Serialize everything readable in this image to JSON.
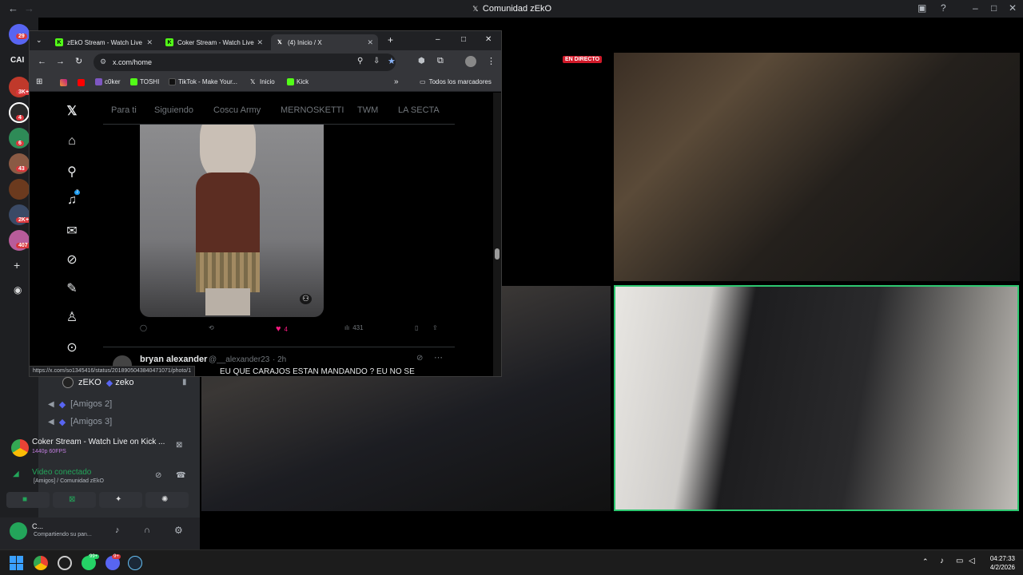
{
  "discord": {
    "window_title": "Comunidad zEkO",
    "channel_header": "Comunidad zEkO",
    "server_badges": [
      "29",
      "3K+",
      "4",
      "6",
      "43",
      "2K+",
      "407"
    ],
    "voice_channel": {
      "user": "zEKO",
      "user_tag": "zeko",
      "sub_channels": [
        "[Amigos 2]",
        "[Amigos 3]"
      ]
    },
    "stream_panel": {
      "title": "Coker Stream - Watch Live on Kick ...",
      "quality": "1440p 60FPS"
    },
    "voice_panel": {
      "status": "Video conectado",
      "location": "[Amigos] / Comunidad zEkO"
    },
    "user_panel": {
      "name": "C...",
      "status": "Compartiendo su pan..."
    },
    "server_label": "CAI"
  },
  "stream": {
    "live_badge": "EN DIRECTO"
  },
  "chrome": {
    "tabs": [
      {
        "label": "zEkO Stream - Watch Live",
        "icon": "kick-icon",
        "color": "#53fc18"
      },
      {
        "label": "Coker Stream - Watch Live",
        "icon": "kick-icon",
        "color": "#53fc18"
      },
      {
        "label": "(4) Inicio / X",
        "icon": "x-icon",
        "color": "#ffffff"
      }
    ],
    "url": "x.com/home",
    "bookmarks": [
      {
        "label": "c0ker",
        "color": "#7e57c2"
      },
      {
        "label": "TOSHI",
        "color": "#53fc18"
      },
      {
        "label": "TikTok - Make Your...",
        "color": "#000000"
      },
      {
        "label": "Inicio",
        "color": "#000000"
      },
      {
        "label": "Kick",
        "color": "#53fc18"
      }
    ],
    "all_bookmarks": "Todos los marcadores",
    "status_url": "https://x.com/so1345416/status/2018905043840471071/photo/1"
  },
  "x": {
    "tabs": [
      "Para ti",
      "Siguiendo",
      "Coscu Army",
      "MERNOSKETTI",
      "TWM",
      "LA SECTA"
    ],
    "notification_count": "7",
    "post_actions": {
      "likes": "4",
      "views": "431"
    },
    "next_post": {
      "name": "bryan alexander",
      "handle": "@__alexander23",
      "time": "· 2h",
      "text": "EU QUE CARAJOS ESTAN MANDANDO ? EU NO SE"
    }
  },
  "taskbar": {
    "time": "04:27:33",
    "date": "4/2/2026",
    "whatsapp_badge": "99+",
    "discord_badge": "9+"
  },
  "colors": {
    "discord_bg": "#1e1f22",
    "kick_green": "#53fc18",
    "live_red": "#d11a2a",
    "like_pink": "#f91880"
  }
}
